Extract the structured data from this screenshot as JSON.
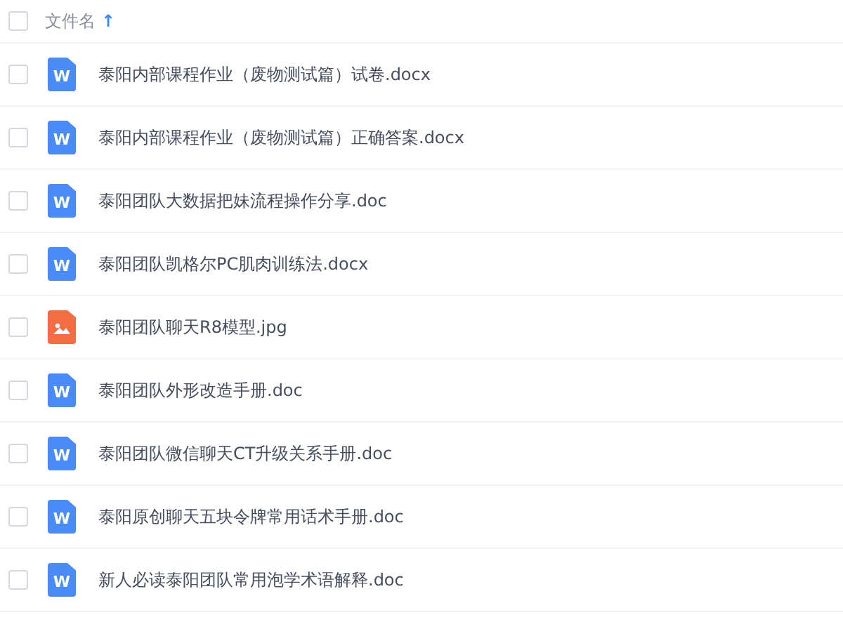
{
  "header": {
    "checked": false,
    "label": "文件名",
    "sort_indicator": "↑"
  },
  "files": [
    {
      "kind": "word",
      "icon_text": "W",
      "name": "泰阳内部课程作业（废物测试篇）试卷.docx",
      "checked": false
    },
    {
      "kind": "word",
      "icon_text": "W",
      "name": "泰阳内部课程作业（废物测试篇）正确答案.docx",
      "checked": false
    },
    {
      "kind": "word",
      "icon_text": "W",
      "name": "泰阳团队大数据把妹流程操作分享.doc",
      "checked": false
    },
    {
      "kind": "word",
      "icon_text": "W",
      "name": "泰阳团队凯格尔PC肌肉训练法.docx",
      "checked": false
    },
    {
      "kind": "image",
      "name": "泰阳团队聊天R8模型.jpg",
      "checked": false
    },
    {
      "kind": "word",
      "icon_text": "W",
      "name": "泰阳团队外形改造手册.doc",
      "checked": false
    },
    {
      "kind": "word",
      "icon_text": "W",
      "name": "泰阳团队微信聊天CT升级关系手册.doc",
      "checked": false
    },
    {
      "kind": "word",
      "icon_text": "W",
      "name": "泰阳原创聊天五块令牌常用话术手册.doc",
      "checked": false
    },
    {
      "kind": "word",
      "icon_text": "W",
      "name": "新人必读泰阳团队常用泡学术语解释.doc",
      "checked": false
    }
  ]
}
